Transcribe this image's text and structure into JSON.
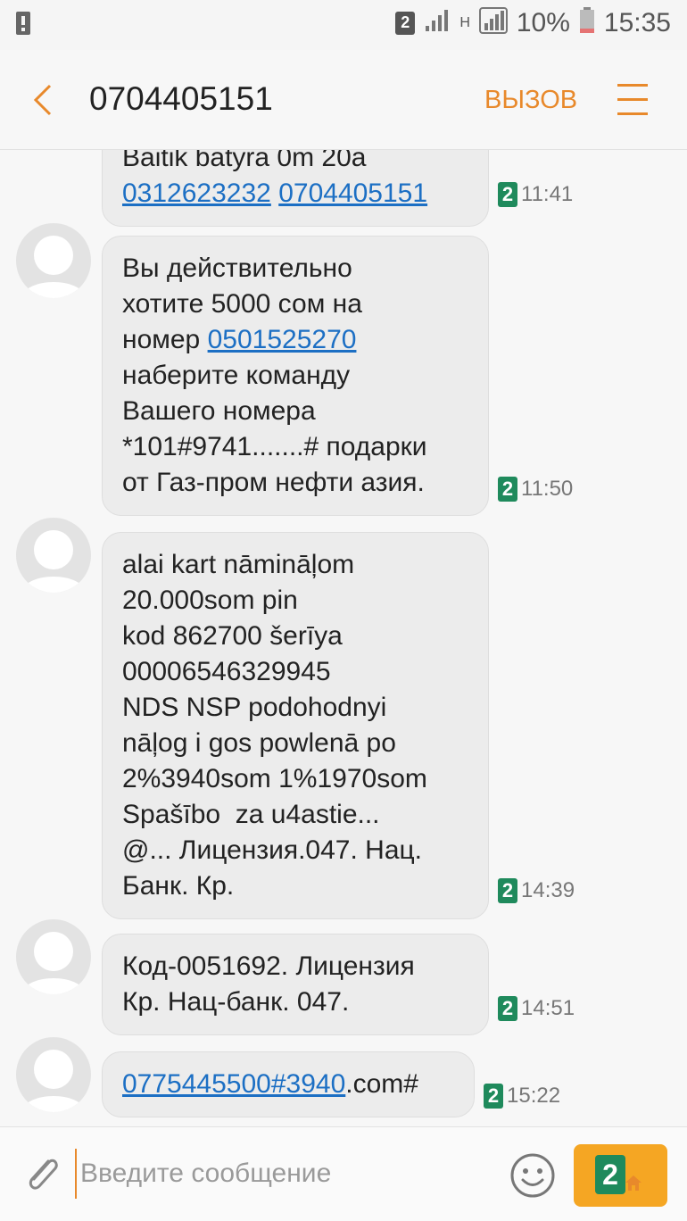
{
  "status_bar": {
    "sim_slot": "2",
    "network": "H",
    "battery": "10%",
    "time": "15:35"
  },
  "header": {
    "title": "0704405151",
    "call_label": "ВЫЗОВ"
  },
  "messages": [
    {
      "partial": true,
      "parts": [
        {
          "text": "Baitik batyra 0m 20a\n",
          "link": false
        },
        {
          "text": "0312623232",
          "link": true
        },
        {
          "text": " ",
          "link": false
        },
        {
          "text": "0704405151",
          "link": true
        }
      ],
      "sim": "2",
      "time": "11:41"
    },
    {
      "parts": [
        {
          "text": "Вы действительно\nхотите 5000 сом на\nномер ",
          "link": false
        },
        {
          "text": "0501525270",
          "link": true
        },
        {
          "text": "\nнаберите команду\nВашего номера\n*101#9741.......# подарки\nот Газ-пром нефти азия.",
          "link": false
        }
      ],
      "sim": "2",
      "time": "11:50"
    },
    {
      "parts": [
        {
          "text": "alai kart nāmināļom\n20.000som pin\nkod 862700 šerīya\n00006546329945\nNDS NSP podohodnyi\nnāļog i gos powlenā po\n2%3940som 1%1970som\nSpašībo  za u4astie...\n@... Лицензия.047. Нац.\nБанк. Кр.",
          "link": false
        }
      ],
      "sim": "2",
      "time": "14:39"
    },
    {
      "parts": [
        {
          "text": "Код-0051692. Лицензия\nКр. Нац-банк. 047.",
          "link": false
        }
      ],
      "sim": "2",
      "time": "14:51"
    },
    {
      "parts": [
        {
          "text": "0775445500#3940",
          "link": true
        },
        {
          "text": ".com#",
          "link": false
        }
      ],
      "sim": "2",
      "time": "15:22"
    }
  ],
  "composer": {
    "placeholder": "Введите сообщение",
    "send_sim": "2"
  },
  "icons": {
    "back": "chevron-left-icon",
    "menu": "hamburger-menu-icon",
    "attach": "paperclip-icon",
    "emoji": "smiley-icon",
    "send": "send-sim-icon"
  },
  "colors": {
    "accent": "#e8892b",
    "sim_badge": "#1f8a5c",
    "link": "#1c6fc4",
    "bubble": "#ececec",
    "send_button": "#f5a623"
  }
}
